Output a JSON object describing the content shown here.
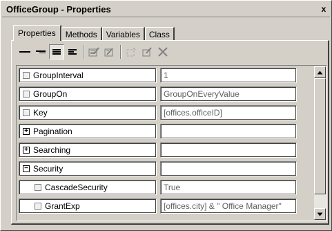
{
  "window": {
    "title": "OfficeGroup - Properties",
    "close_glyph": "x"
  },
  "tabs": [
    {
      "label": "Properties",
      "active": true
    },
    {
      "label": "Methods",
      "active": false
    },
    {
      "label": "Variables",
      "active": false
    },
    {
      "label": "Class",
      "active": false
    }
  ],
  "toolbar": {
    "buttons": [
      {
        "icon": "line-thick-icon"
      },
      {
        "icon": "line-thin-icon"
      },
      {
        "icon": "align-lines-icon",
        "pressed": true
      },
      {
        "icon": "align-left-lines-icon"
      },
      {
        "icon": "edit-properties-icon"
      },
      {
        "icon": "edit-properties-disabled-icon"
      },
      {
        "icon": "new-item-icon"
      },
      {
        "icon": "edit-check-icon"
      },
      {
        "icon": "delete-x-icon"
      }
    ]
  },
  "properties": [
    {
      "name": "GroupInterval",
      "value": "1",
      "marker": "box",
      "indent": false
    },
    {
      "name": "GroupOn",
      "value": "GroupOnEveryValue",
      "marker": "box",
      "indent": false
    },
    {
      "name": "Key",
      "value": "[offices.officeID]",
      "marker": "box",
      "indent": false
    },
    {
      "name": "Pagination",
      "value": "",
      "marker": "plus",
      "indent": false
    },
    {
      "name": "Searching",
      "value": "",
      "marker": "plus",
      "indent": false
    },
    {
      "name": "Security",
      "value": "",
      "marker": "minus",
      "indent": false
    },
    {
      "name": "CascadeSecurity",
      "value": "True",
      "marker": "box",
      "indent": true
    },
    {
      "name": "GrantExp",
      "value": "[offices.city] & \" Office Manager\"",
      "marker": "box",
      "indent": true
    }
  ],
  "colors": {
    "face": "#d4d0c8",
    "value_text": "#606060"
  }
}
